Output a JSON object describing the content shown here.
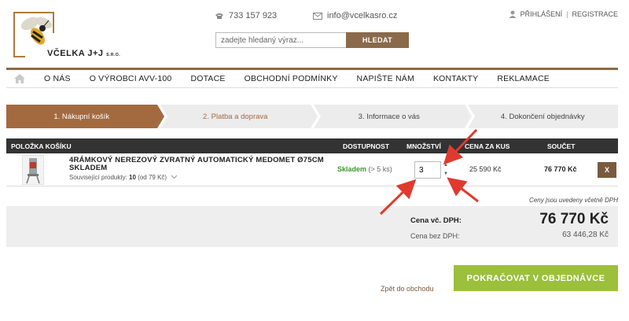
{
  "header": {
    "logo": {
      "name": "VČELKA J+J",
      "suffix": "S.R.O."
    },
    "phone": "733 157 923",
    "email": "info@vcelkasro.cz",
    "account": {
      "login": "PŘIHLÁŠENÍ",
      "separator": "|",
      "register": "REGISTRACE"
    },
    "search": {
      "placeholder": "zadejte hledaný výraz...",
      "button": "HLEDAT"
    }
  },
  "nav": {
    "items": [
      {
        "label": "O NÁS"
      },
      {
        "label": "O VÝROBCI AVV-100"
      },
      {
        "label": "DOTACE"
      },
      {
        "label": "OBCHODNÍ PODMÍNKY"
      },
      {
        "label": "NAPIŠTE NÁM"
      },
      {
        "label": "KONTAKTY"
      },
      {
        "label": "REKLAMACE"
      }
    ]
  },
  "steps": [
    {
      "label": "1. Nákupní košík"
    },
    {
      "label": "2. Platba a doprava"
    },
    {
      "label": "3. Informace o vás"
    },
    {
      "label": "4. Dokončení objednávky"
    }
  ],
  "cart": {
    "columns": {
      "item": "POLOŽKA KOŠÍKU",
      "availability": "DOSTUPNOST",
      "quantity": "MNOŽSTVÍ",
      "unit_price": "CENA ZA KUS",
      "total": "SOUČET"
    },
    "rows": [
      {
        "name": "4RÁMKOVÝ NEREZOVÝ ZVRATNÝ AUTOMATICKÝ MEDOMET Ø75CM SKLADEM",
        "related_label": "Související produkty:",
        "related_count": "10",
        "related_from": "(od 79 Kč)",
        "stock": "Skladem",
        "stock_detail": "(> 5 ks)",
        "quantity": "3",
        "unit_price": "25 590 Kč",
        "total": "76 770 Kč",
        "remove": "X"
      }
    ]
  },
  "vat_note": "Ceny jsou uvedeny včetně DPH",
  "summary": {
    "with_vat_label": "Cena vč. DPH:",
    "with_vat_value": "76 770 Kč",
    "without_vat_label": "Cena bez DPH:",
    "without_vat_value": "63 446,28 Kč"
  },
  "actions": {
    "back": "Zpět do obchodu",
    "continue": "POKRAČOVAT V OBJEDNÁVCE"
  },
  "colors": {
    "brand_brown": "#a46a3f",
    "header_dark": "#333333",
    "stock_green": "#3a9a2a",
    "continue_green": "#9cbf3c",
    "annotation_red": "#e03a2f"
  }
}
